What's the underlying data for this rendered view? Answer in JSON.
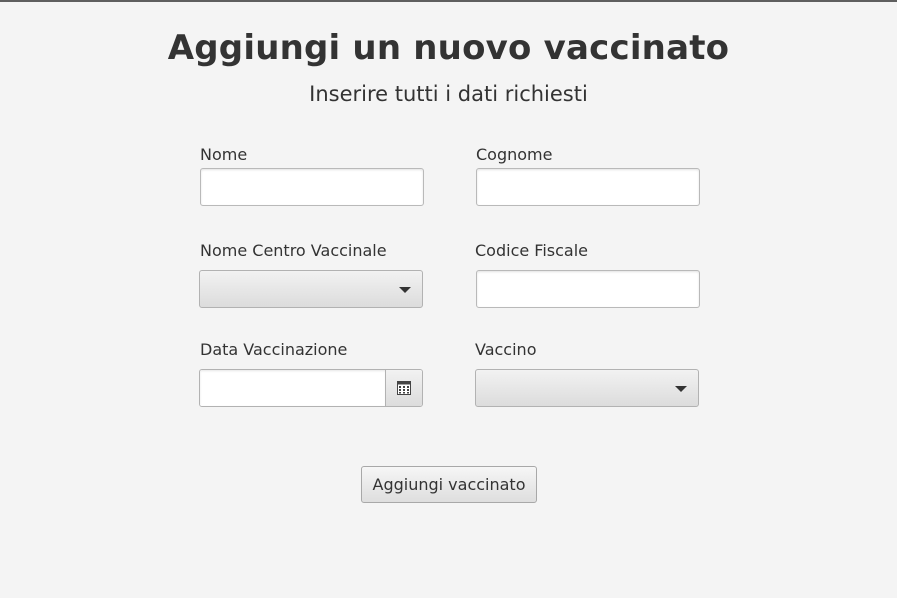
{
  "header": {
    "title": "Aggiungi un nuovo vaccinato",
    "subtitle": "Inserire tutti i dati richiesti"
  },
  "form": {
    "nome": {
      "label": "Nome",
      "value": ""
    },
    "cognome": {
      "label": "Cognome",
      "value": ""
    },
    "centro_vaccinale": {
      "label": "Nome Centro Vaccinale",
      "selected": ""
    },
    "codice_fiscale": {
      "label": "Codice Fiscale",
      "value": ""
    },
    "data_vaccinazione": {
      "label": "Data Vaccinazione",
      "value": "",
      "icon": "calendar-icon"
    },
    "vaccino": {
      "label": "Vaccino",
      "selected": ""
    },
    "submit_label": "Aggiungi vaccinato"
  },
  "colors": {
    "background": "#f4f4f4",
    "text": "#333333",
    "field_border": "#b9b9b9"
  }
}
